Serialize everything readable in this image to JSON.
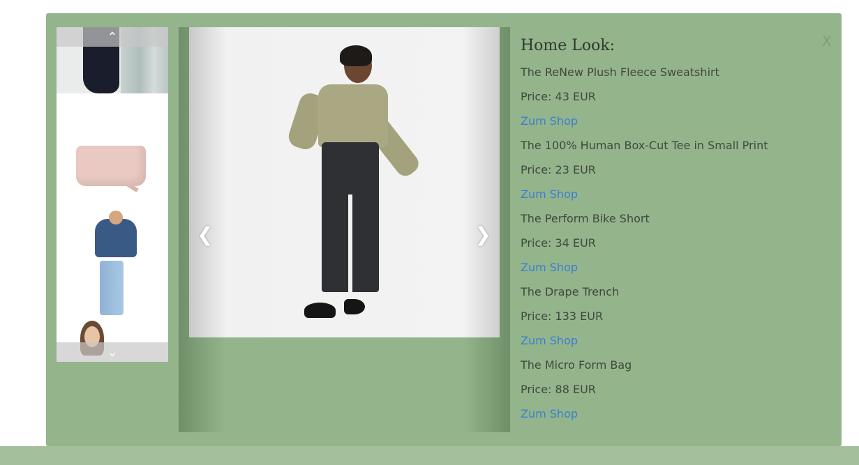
{
  "close_label": "X",
  "look_title": "Home Look:",
  "products": [
    {
      "name": "The ReNew Plush Fleece Sweatshirt",
      "price": "Price: 43 EUR",
      "link": "Zum Shop"
    },
    {
      "name": "The 100% Human Box-Cut Tee in Small Print",
      "price": "Price: 23 EUR",
      "link": "Zum Shop"
    },
    {
      "name": "The Perform Bike Short",
      "price": "Price: 34 EUR",
      "link": "Zum Shop"
    },
    {
      "name": "The Drape Trench",
      "price": "Price: 133 EUR",
      "link": "Zum Shop"
    },
    {
      "name": "The Micro Form Bag",
      "price": "Price: 88 EUR",
      "link": "Zum Shop"
    }
  ],
  "icons": {
    "thumb_up": "chevron-up-icon",
    "thumb_down": "chevron-down-icon",
    "prev": "chevron-left-icon",
    "next": "chevron-right-icon"
  },
  "colors": {
    "modal_bg": "#94b48c",
    "link": "#3a7fd1",
    "text": "#3e4a3c"
  }
}
